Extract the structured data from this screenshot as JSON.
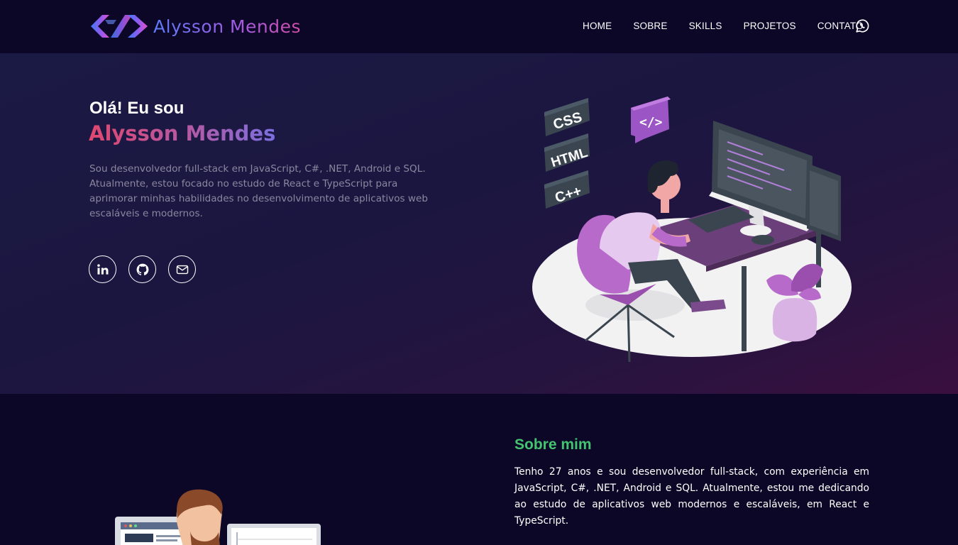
{
  "brand": {
    "name": "Alysson Mendes",
    "logo_icon": "code-brackets-logo"
  },
  "nav": {
    "items": [
      {
        "label": "HOME"
      },
      {
        "label": "SOBRE"
      },
      {
        "label": "SKILLS"
      },
      {
        "label": "PROJETOS"
      },
      {
        "label": "CONTATO"
      }
    ],
    "whatsapp_icon": "whatsapp-icon"
  },
  "hero": {
    "greeting": "Olá! Eu sou",
    "name": "Alysson Mendes",
    "description": "Sou desenvolvedor full-stack em JavaScript, C#, .NET, Android e SQL. Atualmente, estou focado no estudo de React e TypeScript para aprimorar minhas habilidades no desenvolvimento de aplicativos web escaláveis e modernos.",
    "socials": [
      {
        "icon": "linkedin-icon"
      },
      {
        "icon": "github-icon"
      },
      {
        "icon": "email-icon"
      }
    ],
    "illustration_tags": [
      "CSS",
      "HTML",
      "C++"
    ]
  },
  "about": {
    "title": "Sobre mim",
    "text": "Tenho 27 anos e sou desenvolvedor full-stack, com experiência em JavaScript, C#, .NET, Android e SQL. Atualmente, estou me dedicando ao estudo de aplicativos web modernos e escaláveis, em React e TypeScript."
  },
  "colors": {
    "background": "#0c0627",
    "accent_green": "#43c46f",
    "accent_purple": "#a05ce6",
    "accent_pink": "#e0476e"
  }
}
